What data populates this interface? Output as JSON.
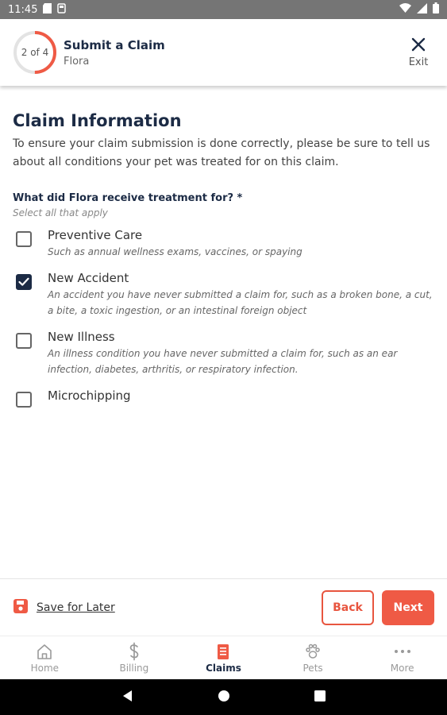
{
  "status_bar": {
    "time": "11:45"
  },
  "header": {
    "progress_text": "2 of 4",
    "progress_fraction": 0.5,
    "title": "Submit a Claim",
    "subtitle": "Flora",
    "exit_label": "Exit",
    "accent_color": "#ef5a45"
  },
  "main": {
    "title": "Claim Information",
    "description": "To ensure your claim submission is done correctly, please be sure to tell us about all conditions your pet was treated for on this claim.",
    "question": "What did Flora receive treatment for? *",
    "hint": "Select all that apply",
    "options": [
      {
        "label": "Preventive Care",
        "description": "Such as annual wellness exams, vaccines, or spaying",
        "checked": false
      },
      {
        "label": "New Accident",
        "description": "An accident you have never submitted a claim for, such as a broken bone, a cut, a bite, a toxic ingestion, or an intestinal foreign object",
        "checked": true
      },
      {
        "label": "New Illness",
        "description": "An illness condition you have never submitted a claim for, such as an ear infection, diabetes, arthritis, or respiratory infection.",
        "checked": false
      },
      {
        "label": "Microchipping",
        "description": "",
        "checked": false
      }
    ]
  },
  "actions": {
    "save_label": "Save for Later",
    "back_label": "Back",
    "next_label": "Next"
  },
  "nav": {
    "items": [
      {
        "label": "Home",
        "icon": "home-icon",
        "active": false
      },
      {
        "label": "Billing",
        "icon": "dollar-icon",
        "active": false
      },
      {
        "label": "Claims",
        "icon": "claims-document-icon",
        "active": true
      },
      {
        "label": "Pets",
        "icon": "paw-icon",
        "active": false
      },
      {
        "label": "More",
        "icon": "more-dots-icon",
        "active": false
      }
    ]
  },
  "colors": {
    "navy": "#1c2b45",
    "accent": "#ef5a45"
  }
}
